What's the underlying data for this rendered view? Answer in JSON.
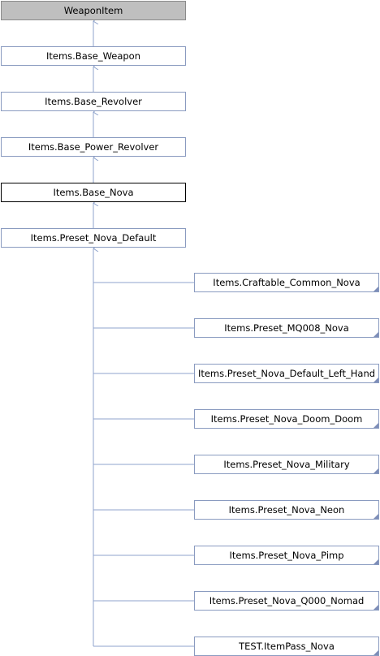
{
  "nodes": {
    "weapon_item": "WeaponItem",
    "base_weapon": "Items.Base_Weapon",
    "base_revolver": "Items.Base_Revolver",
    "base_power_revolver": "Items.Base_Power_Revolver",
    "base_nova": "Items.Base_Nova",
    "preset_nova_default": "Items.Preset_Nova_Default"
  },
  "children": [
    "Items.Craftable_Common_Nova",
    "Items.Preset_MQ008_Nova",
    "Items.Preset_Nova_Default_Left_Hand",
    "Items.Preset_Nova_Doom_Doom",
    "Items.Preset_Nova_Military",
    "Items.Preset_Nova_Neon",
    "Items.Preset_Nova_Pimp",
    "Items.Preset_Nova_Q000_Nomad",
    "TEST.ItemPass_Nova"
  ],
  "colors": {
    "edge": "#8fa3cc",
    "root_fill": "#bfbfbf",
    "node_border": "#8a9bc0"
  }
}
